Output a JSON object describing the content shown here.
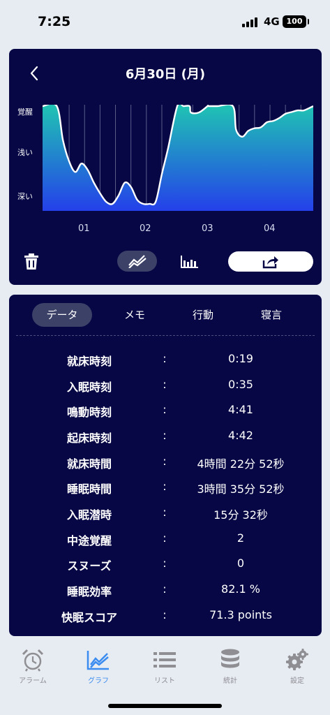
{
  "status": {
    "time": "7:25",
    "network": "4G",
    "battery": "100"
  },
  "header": {
    "date": "6月30日 (月)"
  },
  "chart_data": {
    "type": "area",
    "y_categories": [
      "覚醒",
      "浅い",
      "深い"
    ],
    "x_ticks": [
      "01",
      "02",
      "03",
      "04"
    ],
    "x_unit": "hour",
    "x_range": [
      0.32,
      4.7
    ],
    "y_range_level": [
      0,
      2
    ],
    "series": [
      {
        "x": [
          0.32,
          0.55,
          0.65,
          0.75,
          0.85,
          0.95,
          1.05,
          1.15,
          1.25,
          1.35,
          1.45,
          1.55,
          1.65,
          1.75,
          1.85,
          1.95,
          2.05,
          2.15,
          2.25,
          2.35,
          2.5,
          2.6,
          2.7,
          2.72,
          2.85,
          2.99,
          3.0,
          3.15,
          3.4,
          3.45,
          3.55,
          3.65,
          3.75,
          3.85,
          3.95,
          4.05,
          4.15,
          4.25,
          4.35,
          4.45,
          4.55,
          4.7
        ],
        "depth_level": [
          0.0,
          0.0,
          0.8,
          1.3,
          1.55,
          1.35,
          1.5,
          1.8,
          2.05,
          2.25,
          2.3,
          2.1,
          1.8,
          1.9,
          2.2,
          2.3,
          2.3,
          2.25,
          1.6,
          1.0,
          0.0,
          0.0,
          0.0,
          0.15,
          0.15,
          0.0,
          0.0,
          0.0,
          0.0,
          0.55,
          0.72,
          0.58,
          0.52,
          0.5,
          0.38,
          0.35,
          0.28,
          0.18,
          0.14,
          0.1,
          0.1,
          0.0
        ]
      }
    ]
  },
  "toolbar": {
    "delete_icon": "trash-icon",
    "line_icon": "line-chart-icon",
    "bar_icon": "bar-chart-icon",
    "share_icon": "share-icon"
  },
  "tabs": [
    {
      "label": "データ"
    },
    {
      "label": "メモ"
    },
    {
      "label": "行動"
    },
    {
      "label": "寝言"
    }
  ],
  "rows": [
    {
      "label": "就床時刻",
      "colon": ":",
      "value": "0:19"
    },
    {
      "label": "入眠時刻",
      "colon": ":",
      "value": "0:35"
    },
    {
      "label": "鳴動時刻",
      "colon": ":",
      "value": "4:41"
    },
    {
      "label": "起床時刻",
      "colon": ":",
      "value": "4:42"
    },
    {
      "label": "就床時間",
      "colon": ":",
      "value": "4時間 22分 52秒"
    },
    {
      "label": "睡眠時間",
      "colon": ":",
      "value": "3時間 35分 52秒"
    },
    {
      "label": "入眠潜時",
      "colon": ":",
      "value": "15分 32秒"
    },
    {
      "label": "中途覚醒",
      "colon": ":",
      "value": "2"
    },
    {
      "label": "スヌーズ",
      "colon": ":",
      "value": "0"
    },
    {
      "label": "睡眠効率",
      "colon": ":",
      "value": "82.1 %"
    },
    {
      "label": "快眠スコア",
      "colon": ":",
      "value": "71.3 points"
    }
  ],
  "tabbar": [
    {
      "label": "アラーム",
      "icon": "alarm-clock-icon"
    },
    {
      "label": "グラフ",
      "icon": "line-chart-icon"
    },
    {
      "label": "リスト",
      "icon": "list-icon"
    },
    {
      "label": "統計",
      "icon": "database-icon"
    },
    {
      "label": "設定",
      "icon": "gear-icon"
    }
  ],
  "colors": {
    "card_bg": "#070745",
    "accent": "#3b8cf0",
    "chart_top": "#20c6b2",
    "chart_bottom": "#2440ea"
  }
}
